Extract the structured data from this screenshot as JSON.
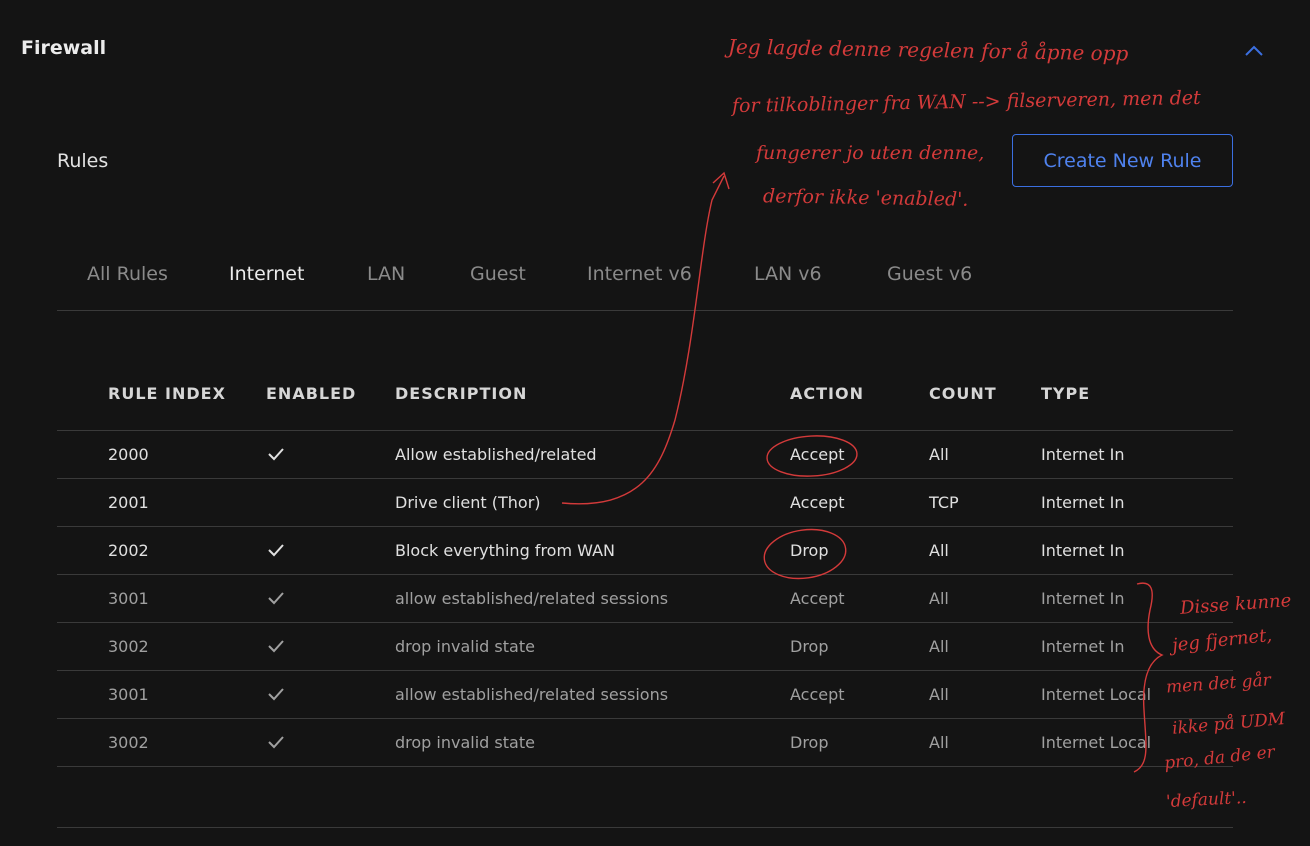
{
  "header": {
    "title": "Firewall"
  },
  "rules": {
    "title": "Rules",
    "create_label": "Create New Rule"
  },
  "tabs": [
    {
      "label": "All Rules",
      "active": false
    },
    {
      "label": "Internet",
      "active": true
    },
    {
      "label": "LAN",
      "active": false
    },
    {
      "label": "Guest",
      "active": false
    },
    {
      "label": "Internet v6",
      "active": false
    },
    {
      "label": "LAN v6",
      "active": false
    },
    {
      "label": "Guest v6",
      "active": false
    }
  ],
  "table": {
    "columns": [
      "RULE INDEX",
      "ENABLED",
      "DESCRIPTION",
      "ACTION",
      "COUNT",
      "TYPE"
    ],
    "rows": [
      {
        "index": "2000",
        "enabled": true,
        "description": "Allow established/related",
        "action": "Accept",
        "count": "All",
        "type": "Internet In",
        "dim": false
      },
      {
        "index": "2001",
        "enabled": false,
        "description": "Drive client (Thor)",
        "action": "Accept",
        "count": "TCP",
        "type": "Internet In",
        "dim": false
      },
      {
        "index": "2002",
        "enabled": true,
        "description": "Block everything from WAN",
        "action": "Drop",
        "count": "All",
        "type": "Internet In",
        "dim": false
      },
      {
        "index": "3001",
        "enabled": true,
        "description": "allow established/related sessions",
        "action": "Accept",
        "count": "All",
        "type": "Internet In",
        "dim": true
      },
      {
        "index": "3002",
        "enabled": true,
        "description": "drop invalid state",
        "action": "Drop",
        "count": "All",
        "type": "Internet In",
        "dim": true
      },
      {
        "index": "3001",
        "enabled": true,
        "description": "allow established/related sessions",
        "action": "Accept",
        "count": "All",
        "type": "Internet Local",
        "dim": true
      },
      {
        "index": "3002",
        "enabled": true,
        "description": "drop invalid state",
        "action": "Drop",
        "count": "All",
        "type": "Internet Local",
        "dim": true
      }
    ]
  },
  "annotations": {
    "top_note": [
      "Jeg lagde denne regelen for å åpne opp",
      "for tilkoblinger fra WAN --> filserveren, men det",
      "fungerer jo uten denne,",
      "derfor ikke 'enabled'."
    ],
    "side_note": [
      "Disse kunne",
      "jeg fjernet,",
      "men det går",
      "ikke på UDM",
      "pro, da de er",
      "'default'.."
    ],
    "ink_color": "#d33a3a"
  },
  "colors": {
    "background": "#141414",
    "accent": "#3b6fe0",
    "divider": "#3a3a3a"
  }
}
